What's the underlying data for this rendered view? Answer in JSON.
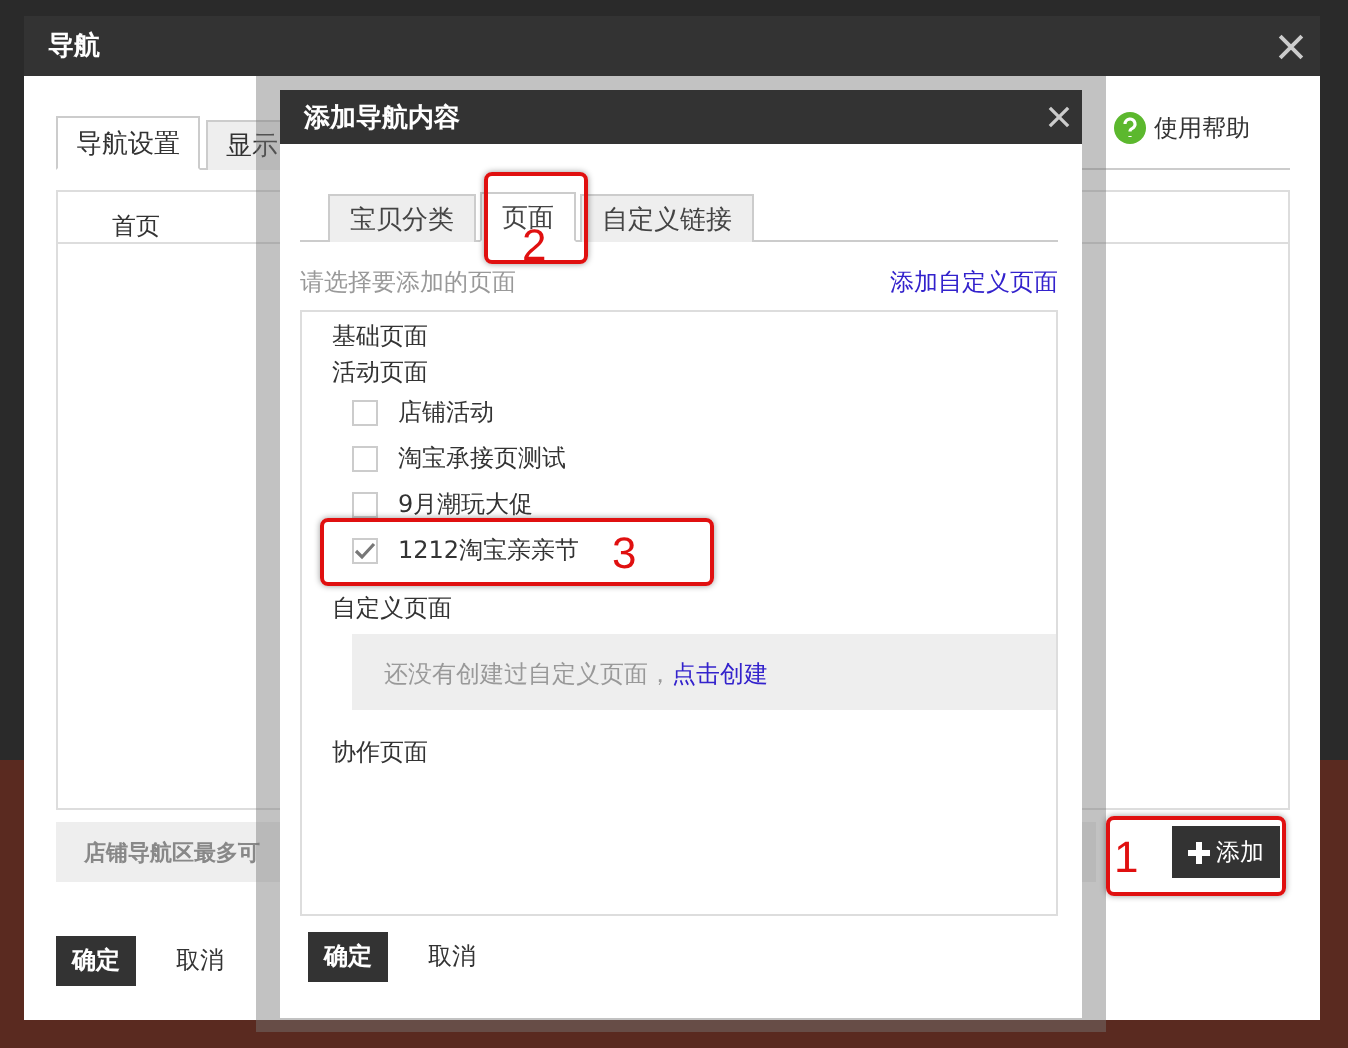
{
  "outer_dialog": {
    "title": "导航",
    "tabs": [
      {
        "label": "导航设置",
        "selected": true
      },
      {
        "label": "显示",
        "selected": false
      }
    ],
    "help": "使用帮助",
    "nav_items": [
      "首页"
    ],
    "notice": "店铺导航区最多可",
    "add_button": "添加",
    "confirm": "确定",
    "cancel": "取消"
  },
  "modal": {
    "title": "添加导航内容",
    "tabs": [
      {
        "label": "宝贝分类",
        "selected": false
      },
      {
        "label": "页面",
        "selected": true
      },
      {
        "label": "自定义链接",
        "selected": false
      }
    ],
    "prompt": "请选择要添加的页面",
    "link": "添加自定义页面",
    "sections": [
      {
        "kind": "heading",
        "title": "基础页面"
      },
      {
        "kind": "group",
        "title": "活动页面",
        "children": [
          {
            "label": "店铺活动",
            "checked": false
          },
          {
            "label": "淘宝承接页测试",
            "checked": false
          },
          {
            "label": "9月潮玩大促",
            "checked": false
          },
          {
            "label": "1212淘宝亲亲节",
            "checked": true
          }
        ]
      },
      {
        "kind": "empty",
        "title": "自定义页面",
        "message": "还没有创建过自定义页面，",
        "link": "点击创建"
      },
      {
        "kind": "heading",
        "title": "协作页面"
      }
    ],
    "confirm": "确定",
    "cancel": "取消"
  },
  "annotations": [
    {
      "number": "1"
    },
    {
      "number": "2"
    },
    {
      "number": "3"
    }
  ]
}
